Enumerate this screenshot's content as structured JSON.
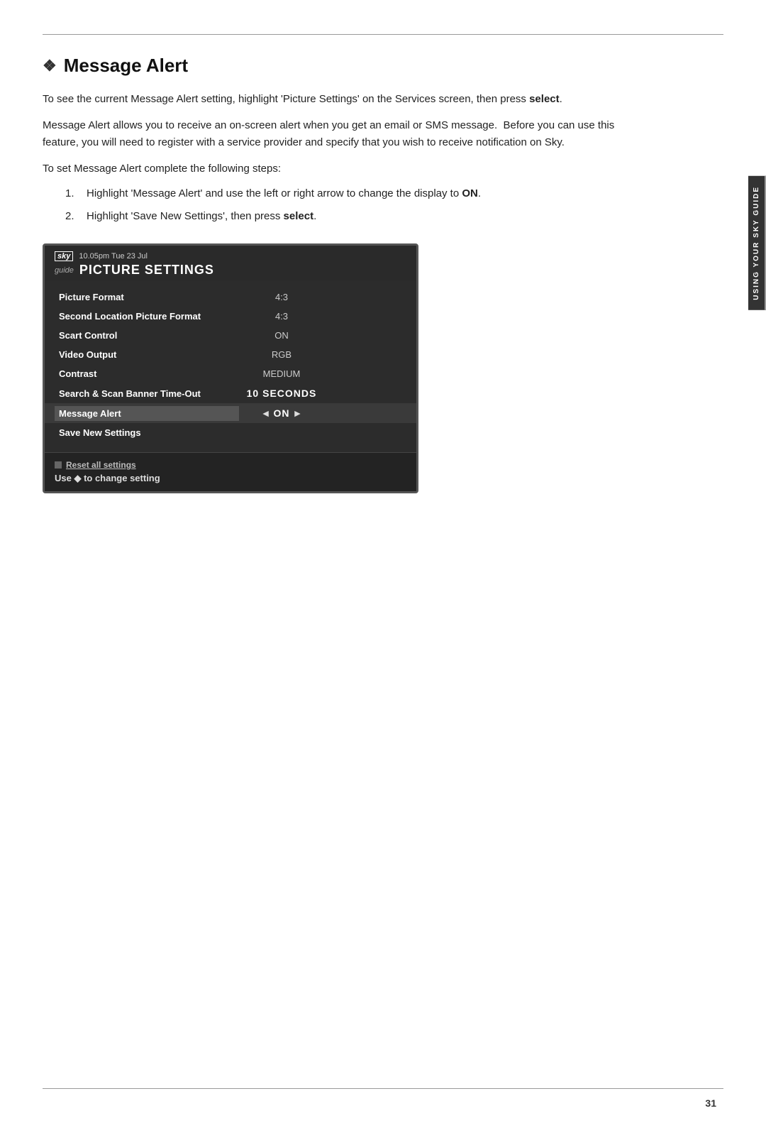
{
  "page": {
    "number": "31"
  },
  "section": {
    "icon": "❖",
    "title": "Message Alert",
    "paragraphs": [
      "To see the current Message Alert setting, highlight 'Picture Settings' on the Services screen, then press select.",
      "Message Alert allows you to receive an on-screen alert when you get an email or SMS message.  Before you can use this feature, you will need to register with a service provider and specify that you wish to receive notification on Sky.",
      "To set Message Alert complete the following steps:"
    ],
    "steps": [
      {
        "num": "1.",
        "text_before": "Highlight 'Message Alert' and use the left or right arrow to change the display to ",
        "bold": "ON",
        "text_after": "."
      },
      {
        "num": "2.",
        "text_before": "Highlight 'Save New Settings', then press ",
        "bold": "select",
        "text_after": "."
      }
    ]
  },
  "tv": {
    "logo": "sky",
    "time": "10.05pm Tue 23 Jul",
    "guide_label": "guide",
    "title": "PICTURE SETTINGS",
    "rows": [
      {
        "label": "Picture Format",
        "value": "4:3",
        "highlighted": false,
        "active": false
      },
      {
        "label": "Second Location Picture Format",
        "value": "4:3",
        "highlighted": false,
        "active": false
      },
      {
        "label": "Scart Control",
        "value": "ON",
        "highlighted": false,
        "active": false
      },
      {
        "label": "Video Output",
        "value": "RGB",
        "highlighted": false,
        "active": false
      },
      {
        "label": "Contrast",
        "value": "MEDIUM",
        "highlighted": false,
        "active": false
      },
      {
        "label": "Search & Scan Banner Time-Out",
        "value": "10 SECONDS",
        "highlighted": true,
        "active": false
      },
      {
        "label": "Message Alert",
        "value": "ON",
        "highlighted": true,
        "active": true,
        "arrows": true
      },
      {
        "label": "Save New Settings",
        "value": "",
        "highlighted": false,
        "active": false
      }
    ],
    "footer": {
      "reset_text": "Reset all settings",
      "use_arrows": "Use ◆ to change setting"
    }
  },
  "side_tab": {
    "text": "USING YOUR SKY GUIDE"
  }
}
